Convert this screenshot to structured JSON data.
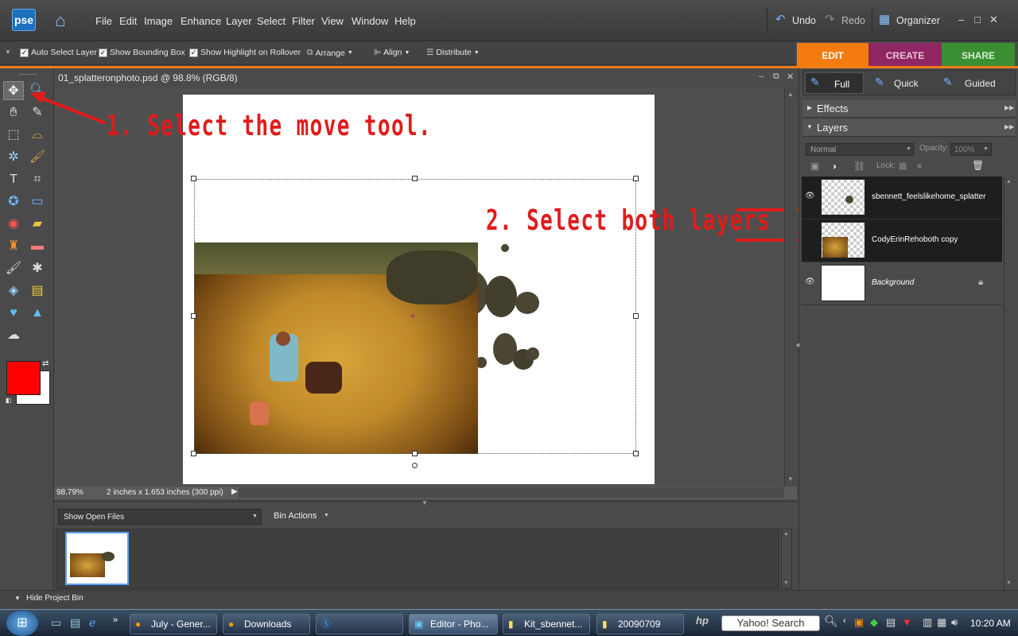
{
  "app": {
    "logo": "pse",
    "title_menus": [
      "File",
      "Edit",
      "Image",
      "Enhance",
      "Layer",
      "Select",
      "Filter",
      "View",
      "Window",
      "Help"
    ]
  },
  "header": {
    "undo": "Undo",
    "redo": "Redo",
    "organizer": "Organizer",
    "win_min": "–",
    "win_max": "□",
    "win_close": "✕"
  },
  "options_bar": {
    "auto_select_layer": "Auto Select Layer",
    "show_bounding_box": "Show Bounding Box",
    "show_highlight": "Show Highlight on Rollover",
    "arrange": "Arrange",
    "align": "Align",
    "distribute": "Distribute"
  },
  "mode_tabs": [
    {
      "label": "EDIT",
      "color": "#f47c0e",
      "active": true
    },
    {
      "label": "CREATE",
      "color": "#9c2b6c",
      "active": false
    },
    {
      "label": "SHARE",
      "color": "#3c9a35",
      "active": false
    }
  ],
  "edit_modes": {
    "full": "Full",
    "quick": "Quick",
    "guided": "Guided"
  },
  "document": {
    "title": "01_splatteronphoto.psd @ 98.8% (RGB/8)"
  },
  "annotations": {
    "step1": "1. Select the move tool.",
    "step2": "2. Select both layers"
  },
  "status": {
    "zoom": "98.79%",
    "doc_info": "2 inches x 1.653 inches (300 ppi)"
  },
  "bin": {
    "show_dropdown": "Show Open Files",
    "bin_actions": "Bin Actions",
    "hide_label": "Hide Project Bin"
  },
  "panels": {
    "effects": "Effects",
    "layers": "Layers",
    "blend_mode": "Normal",
    "opacity_label": "Opacity:",
    "opacity_value": "100%",
    "lock_label": "Lock:",
    "layers_list": [
      {
        "name": "sbennett_feelslikehome_splatter",
        "selected": true,
        "visible": true,
        "italic": false
      },
      {
        "name": "CodyErinRehoboth copy",
        "selected": true,
        "visible": false,
        "italic": false
      },
      {
        "name": "Background",
        "selected": false,
        "visible": true,
        "italic": true,
        "locked": true
      }
    ]
  },
  "colors": {
    "foreground": "#ff0000",
    "background": "#ffffff",
    "accent": "#f07d19"
  },
  "taskbar": {
    "items": [
      "July - Gener...",
      "Downloads",
      "",
      "Editor - Pho...",
      "Kit_sbennet...",
      "20090709"
    ],
    "search_placeholder": "Yahoo! Search",
    "clock": "10:20 AM"
  }
}
